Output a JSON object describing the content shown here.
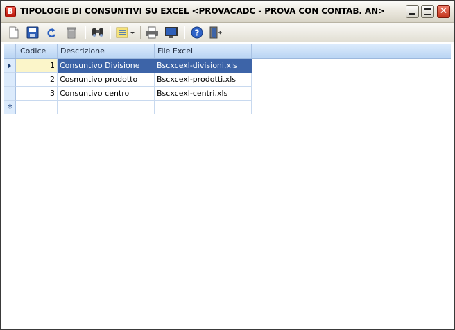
{
  "window": {
    "title": "TIPOLOGIE DI CONSUNTIVI SU EXCEL <PROVACADC - PROVA CON CONTAB. AN>",
    "app_icon_letter": "B"
  },
  "toolbar": {
    "buttons": [
      "new-document-icon",
      "save-icon",
      "undo-icon",
      "delete-icon",
      "find-icon",
      "list-view-icon",
      "print-icon",
      "screen-preview-icon",
      "help-icon",
      "exit-icon"
    ]
  },
  "grid": {
    "columns": [
      "Codice",
      "Descrizione",
      "File Excel"
    ],
    "rows": [
      {
        "codice": "1",
        "descrizione": "Consuntivo Divisione",
        "file": "Bscxcexl-divisioni.xls"
      },
      {
        "codice": "2",
        "descrizione": "Cosnuntivo prodotto",
        "file": "Bscxcexl-prodotti.xls"
      },
      {
        "codice": "3",
        "descrizione": "Consuntivo centro",
        "file": "Bscxcexl-centri.xls"
      }
    ],
    "new_row_marker": "✻"
  }
}
